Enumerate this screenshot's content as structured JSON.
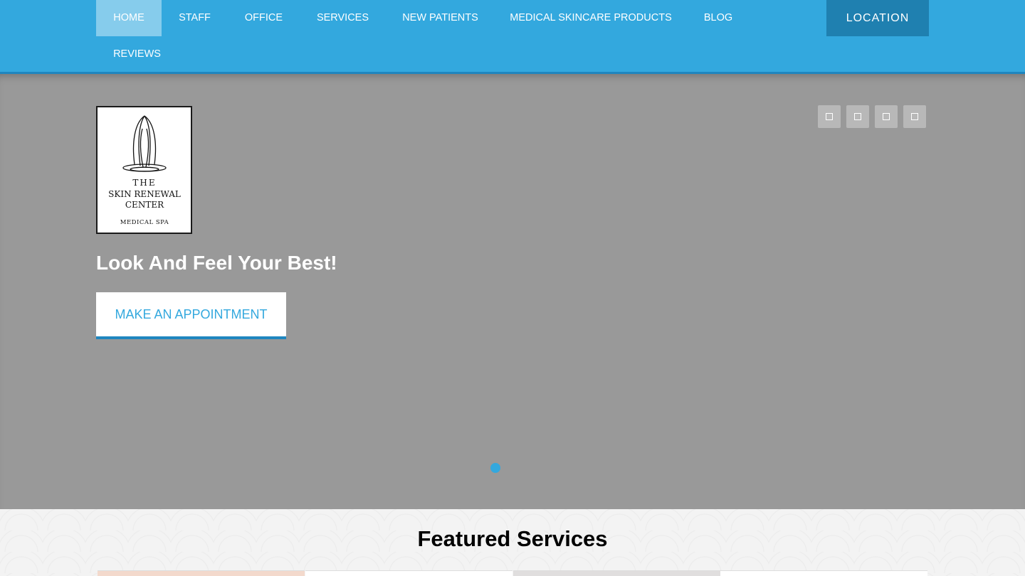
{
  "nav": {
    "items": [
      {
        "label": "HOME",
        "active": true
      },
      {
        "label": "STAFF"
      },
      {
        "label": "OFFICE"
      },
      {
        "label": "SERVICES"
      },
      {
        "label": "NEW PATIENTS"
      },
      {
        "label": "MEDICAL SKINCARE PRODUCTS"
      },
      {
        "label": "BLOG"
      },
      {
        "label": "REVIEWS"
      }
    ],
    "location_label": "LOCATION"
  },
  "hero": {
    "logo": {
      "line1": "THE",
      "line2": "SKIN RENEWAL",
      "line3": "CENTER",
      "line4": "MEDICAL SPA"
    },
    "title": "Look And Feel Your Best!",
    "cta_label": "MAKE AN APPOINTMENT",
    "social_icons": [
      "social-icon",
      "social-icon",
      "social-icon",
      "social-icon"
    ]
  },
  "featured": {
    "title": "Featured Services"
  },
  "colors": {
    "brand": "#33a8de",
    "brand_dark": "#1f80b0",
    "hero_bg": "#999999"
  }
}
